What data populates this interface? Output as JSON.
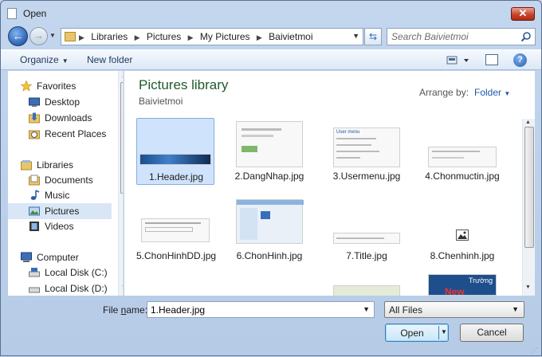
{
  "window": {
    "title": "Open",
    "close_label": "✕"
  },
  "navigation": {
    "breadcrumbs": [
      "Libraries",
      "Pictures",
      "My Pictures",
      "Baivietmoi"
    ],
    "search_placeholder": "Search Baivietmoi"
  },
  "toolbar": {
    "organize_label": "Organize",
    "new_folder_label": "New folder",
    "help_label": "?"
  },
  "sidebar": {
    "favorites": {
      "label": "Favorites",
      "items": [
        "Desktop",
        "Downloads",
        "Recent Places"
      ]
    },
    "libraries": {
      "label": "Libraries",
      "items": [
        "Documents",
        "Music",
        "Pictures",
        "Videos"
      ],
      "selected": "Pictures"
    },
    "computer": {
      "label": "Computer",
      "items": [
        "Local Disk (C:)",
        "Local Disk (D:)"
      ]
    }
  },
  "content": {
    "library_title": "Pictures library",
    "library_subtitle": "Baivietmoi",
    "arrange_label": "Arrange by:",
    "arrange_value": "Folder",
    "files": [
      {
        "name": "1.Header.jpg",
        "selected": true
      },
      {
        "name": "2.DangNhap.jpg"
      },
      {
        "name": "3.Usermenu.jpg"
      },
      {
        "name": "4.Chonmuctin.jpg"
      },
      {
        "name": "5.ChonHinhDD.jpg"
      },
      {
        "name": "6.ChonHinh.jpg"
      },
      {
        "name": "7.Title.jpg"
      },
      {
        "name": "8.Chenhinh.jpg"
      }
    ],
    "thumb_texts": {
      "usermenu_title": "User menu",
      "banner_word": "New",
      "banner_brand": "Trường"
    }
  },
  "bottom": {
    "file_name_label_pre": "File ",
    "file_name_label_key": "n",
    "file_name_label_post": "ame:",
    "file_name_value": "1.Header.jpg",
    "file_type_value": "All Files",
    "open_label": "Open",
    "cancel_label": "Cancel"
  },
  "colors": {
    "accent": "#1e5aa8",
    "library_title": "#1e5b2c",
    "selection": "#cfe3fc"
  }
}
